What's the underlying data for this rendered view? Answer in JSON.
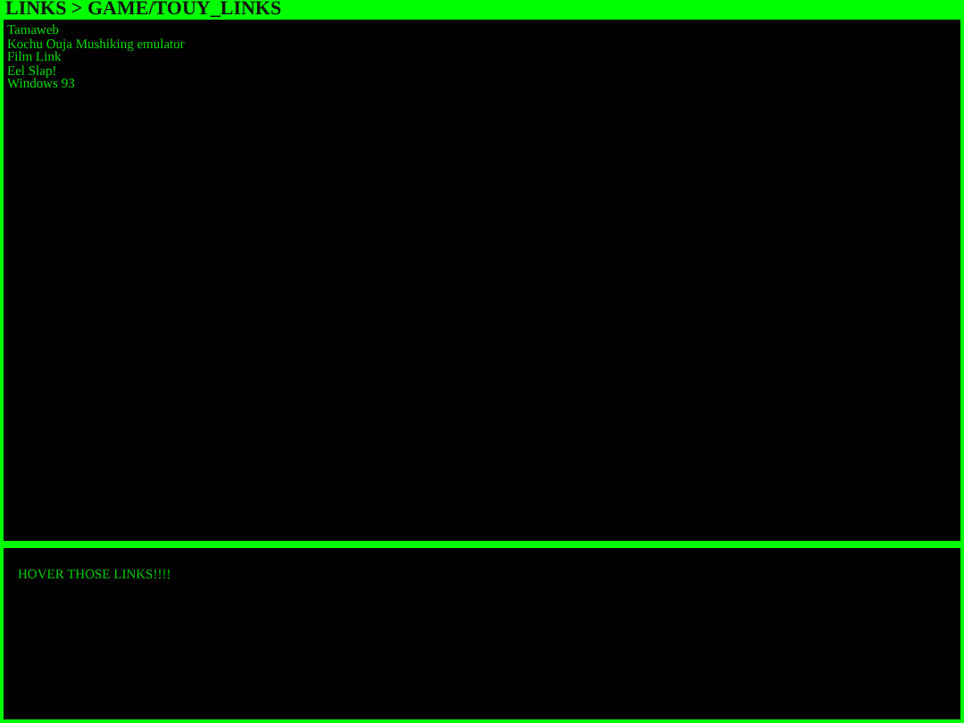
{
  "header": {
    "title": "LINKS > GAME/TOUY_LINKS"
  },
  "links": [
    "Tamaweb",
    "Kochu Ouja Mushiking emulator",
    "Film Link",
    "Eel Slap!",
    "Windows 93"
  ],
  "info_panel": {
    "text": "HOVER THOSE LINKS!!!!"
  }
}
